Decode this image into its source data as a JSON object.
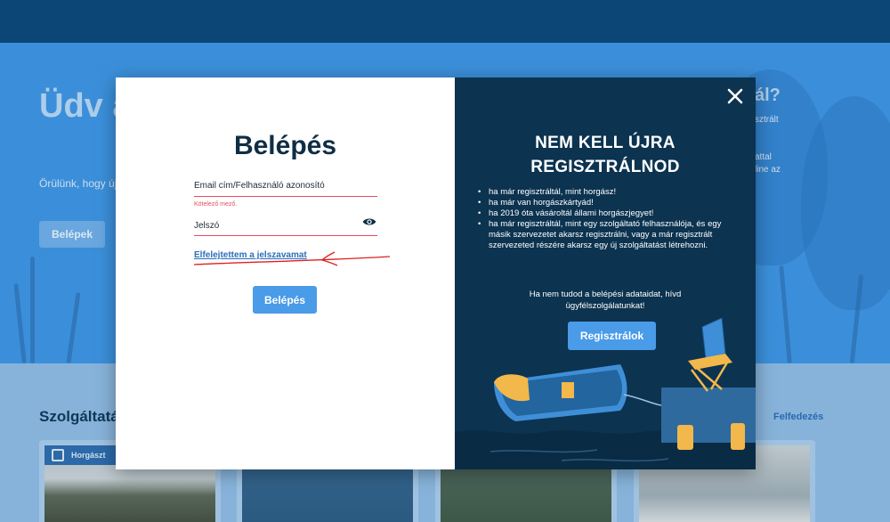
{
  "background": {
    "hero_title": "Üdv a horgászoknál",
    "hero_text": "Örülünk, hogy újra megjelenítéséhez",
    "hero_button": "Belépek",
    "hero_right_title": "ál?",
    "hero_right_text": [
      "sztrált",
      "",
      "",
      "attal",
      "line az"
    ],
    "section_title": "Szolgáltatások",
    "section_link": "Felfedezés",
    "card_badge": "Horgászt"
  },
  "login": {
    "title": "Belépés",
    "email_label": "Email cím/Felhasználó azonosító",
    "email_error": "Kötelező mező.",
    "password_label": "Jelszó",
    "forgot_link": "Elfelejtettem a jelszavamat",
    "submit": "Belépés"
  },
  "register": {
    "title_line1": "NEM KELL ÚJRA",
    "title_line2": "REGISZTRÁLNOD",
    "bullets": [
      "ha már regisztráltál, mint horgász!",
      "ha már van horgászkártyád!",
      "ha 2019 óta vásároltál állami horgászjegyet!",
      "ha már regisztráltál, mint egy szolgáltató felhasználója, és egy másik szervezetet akarsz regisztrálni, vagy a már regisztrált szervezeted részére akarsz egy új szolgáltatást létrehozni."
    ],
    "help_text_line1": "Ha nem tudod a belépési adataidat, hívd",
    "help_text_line2": "ügyfélszolgálatunkat!",
    "button": "Regisztrálok"
  },
  "colors": {
    "accent": "#4a9be8",
    "panel_dark": "#0c3350",
    "error": "#e84a5f",
    "link": "#2a6fba"
  },
  "icons": [
    "eye-icon",
    "close-icon"
  ]
}
